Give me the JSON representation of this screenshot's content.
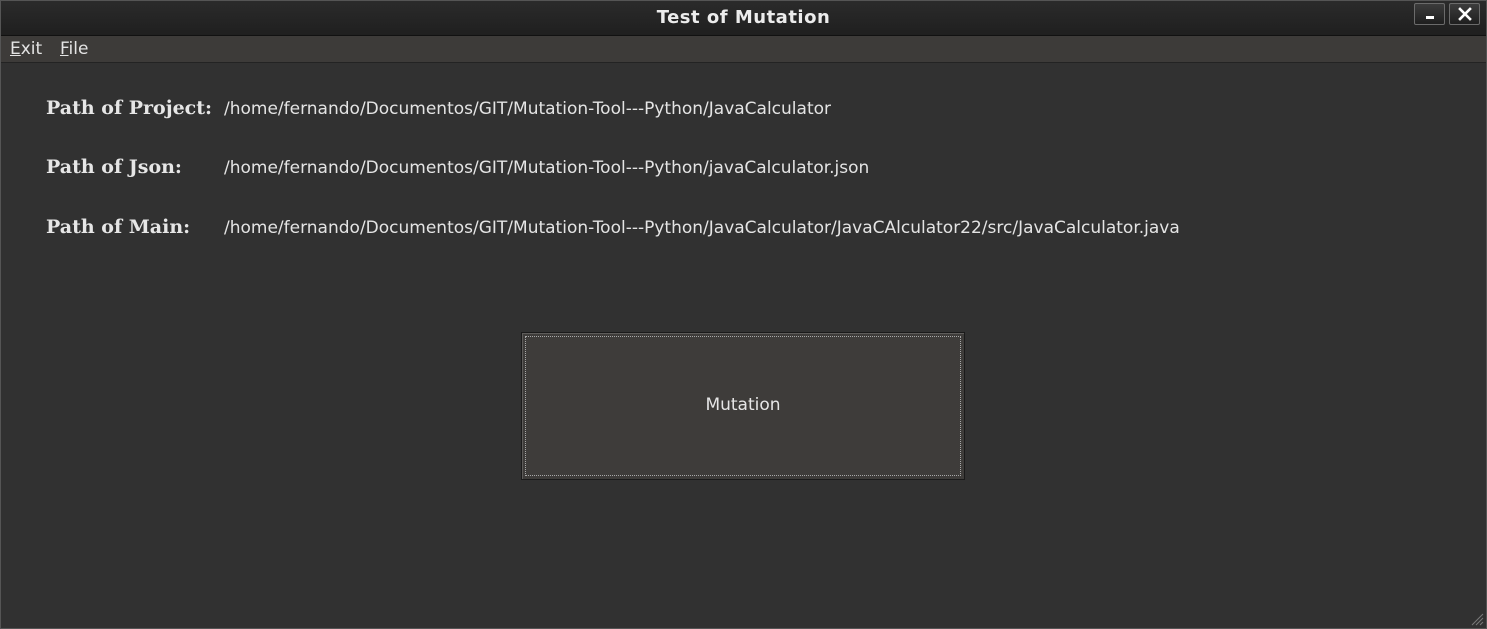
{
  "window": {
    "title": "Test of Mutation"
  },
  "titlebar_buttons": {
    "minimize_icon": "minimize-icon",
    "close_icon": "close-icon"
  },
  "menubar": {
    "items": [
      {
        "label_mnemonic": "E",
        "label_rest": "xit"
      },
      {
        "label_mnemonic": "F",
        "label_rest": "ile"
      }
    ]
  },
  "fields": [
    {
      "label": "Path of Project:",
      "value": "/home/fernando/Documentos/GIT/Mutation-Tool---Python/JavaCalculator"
    },
    {
      "label": "Path of Json:",
      "value": "/home/fernando/Documentos/GIT/Mutation-Tool---Python/javaCalculator.json"
    },
    {
      "label": "Path of Main:",
      "value": "/home/fernando/Documentos/GIT/Mutation-Tool---Python/JavaCalculator/JavaCAlculator22/src/JavaCalculator.java"
    }
  ],
  "mutation_button": {
    "label": "Mutation"
  },
  "colors": {
    "background": "#313131",
    "menubar": "#3d3b39",
    "titlebar": "#1f1f1f",
    "text": "#e4e4e4"
  }
}
